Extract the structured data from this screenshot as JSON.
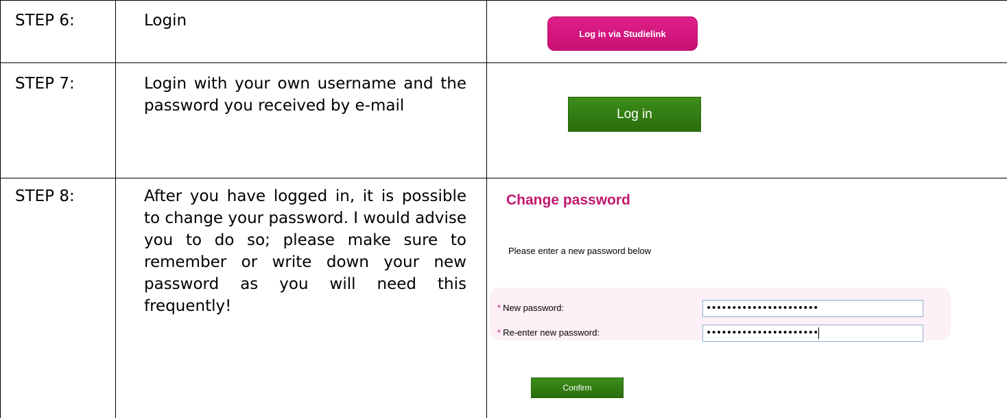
{
  "steps": [
    {
      "label": "STEP 6:",
      "text": "Login"
    },
    {
      "label": "STEP 7:",
      "text": "Login with your own username and the password you received by e-mail"
    },
    {
      "label": "STEP 8:",
      "text": "After you have logged in, it is possible to change your password. I would advise you to do so; please make sure to remember or write down your new password as you will need this frequently!"
    }
  ],
  "studielink_button": {
    "label": "Log in via Studielink"
  },
  "login_button": {
    "label": "Log in"
  },
  "change_password": {
    "title": "Change password",
    "subtitle": "Please enter a new password below",
    "required_marker": "*",
    "new_password_label": "New password:",
    "new_password_value": "••••••••••••••••••••••",
    "reenter_label": "Re-enter new password:",
    "reenter_value": "••••••••••••••••••••••",
    "confirm_label": "Confirm"
  },
  "colors": {
    "brand_pink": "#c1176f",
    "button_green": "#2f7a12",
    "form_bg": "#fdf0f6"
  }
}
